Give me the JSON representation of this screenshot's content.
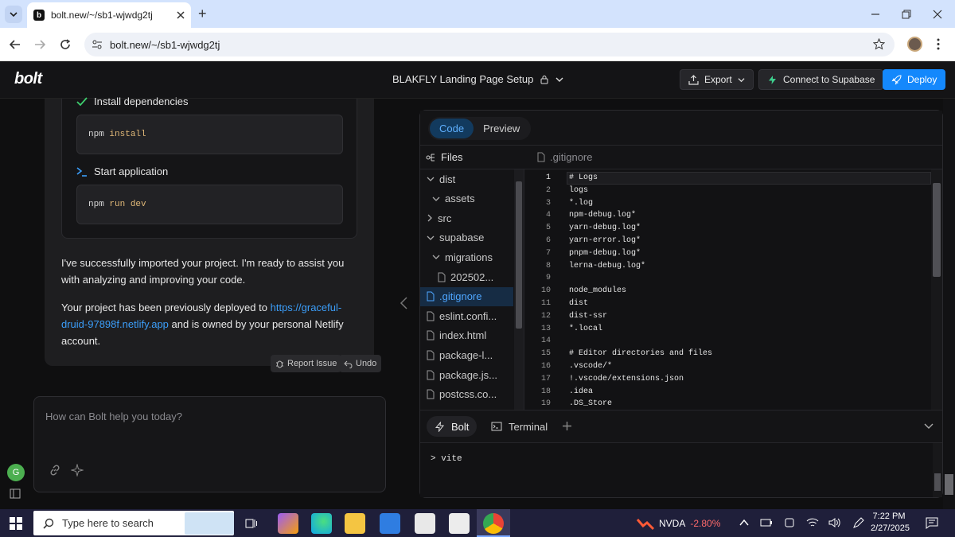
{
  "browser": {
    "tab_title": "bolt.new/~/sb1-wjwdg2tj",
    "url": "bolt.new/~/sb1-wjwdg2tj",
    "new_tab": "+",
    "favicon_letter": "b"
  },
  "header": {
    "logo": "bolt",
    "project_title": "BLAKFLY Landing Page Setup",
    "export_label": "Export",
    "supabase_label": "Connect to Supabase",
    "deploy_label": "Deploy",
    "accent": "#1488fc"
  },
  "chat": {
    "steps": [
      {
        "label": "Install dependencies",
        "icon": "check-icon",
        "cmd_tool": "npm",
        "cmd_args": "install"
      },
      {
        "label": "Start application",
        "icon": "terminal-icon",
        "cmd_tool": "npm",
        "cmd_args": "run dev"
      }
    ],
    "message1": "I've successfully imported your project. I'm ready to assist you with analyzing and improving your code.",
    "message2_prefix": "Your project has been previously deployed to",
    "message2_link": "https://graceful-druid-97898f.netlify.app",
    "message2_suffix": "and is owned by your personal Netlify account.",
    "report_issue": "Report Issue",
    "undo": "Undo",
    "input_placeholder": "How can Bolt help you today?",
    "user_initial": "G"
  },
  "workbench": {
    "tabs": [
      "Code",
      "Preview"
    ],
    "active_tab": "Code",
    "files_label": "Files",
    "open_file": ".gitignore",
    "tree": [
      {
        "label": "dist",
        "kind": "folder-open",
        "depth": 0
      },
      {
        "label": "assets",
        "kind": "folder-open",
        "depth": 1
      },
      {
        "label": "src",
        "kind": "folder-closed",
        "depth": 0
      },
      {
        "label": "supabase",
        "kind": "folder-open",
        "depth": 0
      },
      {
        "label": "migrations",
        "kind": "folder-open",
        "depth": 1
      },
      {
        "label": "202502...",
        "kind": "file",
        "depth": 2
      },
      {
        "label": ".gitignore",
        "kind": "file",
        "depth": 0,
        "selected": true
      },
      {
        "label": "eslint.confi...",
        "kind": "file",
        "depth": 0
      },
      {
        "label": "index.html",
        "kind": "file",
        "depth": 0
      },
      {
        "label": "package-l...",
        "kind": "file",
        "depth": 0
      },
      {
        "label": "package.js...",
        "kind": "file",
        "depth": 0
      },
      {
        "label": "postcss.co...",
        "kind": "file",
        "depth": 0
      }
    ],
    "code_lines": [
      "# Logs",
      "logs",
      "*.log",
      "npm-debug.log*",
      "yarn-debug.log*",
      "yarn-error.log*",
      "pnpm-debug.log*",
      "lerna-debug.log*",
      "",
      "node_modules",
      "dist",
      "dist-ssr",
      "*.local",
      "",
      "# Editor directories and files",
      ".vscode/*",
      "!.vscode/extensions.json",
      ".idea",
      ".DS_Store"
    ],
    "panel_tabs": [
      "Bolt",
      "Terminal"
    ],
    "terminal_output": "> vite"
  },
  "taskbar": {
    "search_placeholder": "Type here to search",
    "stock_name": "NVDA",
    "stock_change": "-2.80%",
    "stock_color": "#ff6b6b",
    "time": "7:22 PM",
    "date": "2/27/2025"
  }
}
